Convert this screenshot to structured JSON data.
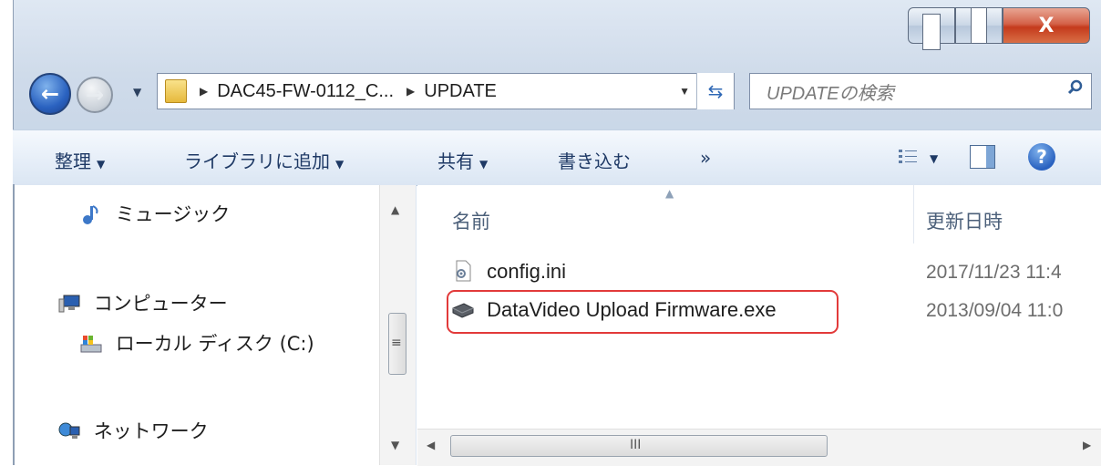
{
  "window": {
    "close_label": "X"
  },
  "address": {
    "crumbs": [
      "DAC45-FW-0112_C...",
      "UPDATE"
    ]
  },
  "search": {
    "placeholder": "UPDATEの検索"
  },
  "toolbar": {
    "organize": "整理",
    "add_library": "ライブラリに追加",
    "share": "共有",
    "burn": "書き込む",
    "more": "»"
  },
  "nav_pane": {
    "items": [
      {
        "label": "ミュージック",
        "icon": "music-icon"
      },
      {
        "label": "コンピューター",
        "icon": "computer-icon"
      },
      {
        "label": "ローカル ディスク (C:)",
        "icon": "disk-icon"
      },
      {
        "label": "ネットワーク",
        "icon": "network-icon"
      }
    ]
  },
  "file_list": {
    "columns": {
      "name": "名前",
      "date": "更新日時"
    },
    "files": [
      {
        "name": "config.ini",
        "date": "2017/11/23 11:4",
        "icon": "settings-file-icon"
      },
      {
        "name": "DataVideo Upload Firmware.exe",
        "date": "2013/09/04 11:0",
        "icon": "exe-file-icon",
        "highlighted": true
      }
    ]
  },
  "colors": {
    "highlight": "#e23a3a",
    "toolbar_text": "#1e3965"
  }
}
